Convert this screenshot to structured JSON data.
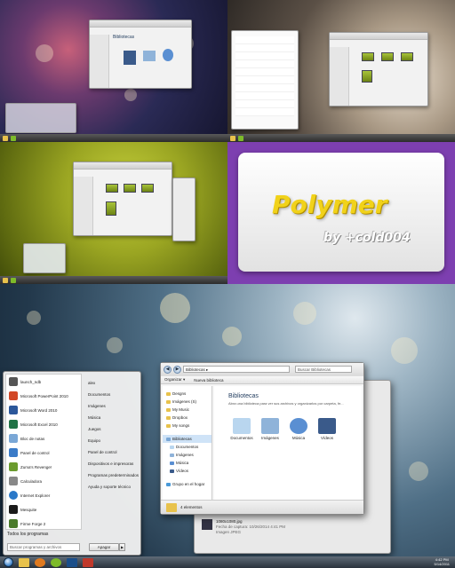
{
  "collage": {
    "polymer_title": "Polymer",
    "polymer_byline": "by +cold004"
  },
  "mini_explorer": {
    "title": "Bibliotecas"
  },
  "start_menu": {
    "programs": [
      {
        "label": "launch_ndb",
        "color": "#555555"
      },
      {
        "label": "Microsoft PowerPoint 2010",
        "color": "#d24726"
      },
      {
        "label": "Microsoft Word 2010",
        "color": "#2b579a"
      },
      {
        "label": "Microsoft Excel 2010",
        "color": "#217346"
      },
      {
        "label": "Bloc de notas",
        "color": "#7aa7d6"
      },
      {
        "label": "Panel de control",
        "color": "#3a7bc8"
      },
      {
        "label": "Zuma's Revenge!",
        "color": "#6b9b2e"
      },
      {
        "label": "Calculadora",
        "color": "#888888"
      },
      {
        "label": "Internet Explorer",
        "color": "#2a78c8"
      },
      {
        "label": "Mesquite",
        "color": "#1a1a1a"
      },
      {
        "label": "Firme Forge 2",
        "color": "#4a7a2a"
      }
    ],
    "all_programs": "Todos los programas",
    "search_placeholder": "Buscar programas y archivos",
    "right_links": [
      "alex",
      "Documentos",
      "Imágenes",
      "Música",
      "Juegos",
      "Equipo",
      "Panel de control",
      "Dispositivos e impresoras",
      "Programas predeterminados",
      "Ayuda y soporte técnico"
    ],
    "shutdown": "Apagar",
    "shutdown_arrow": "▶"
  },
  "explorer": {
    "address": "Bibliotecas ▸",
    "search": "Buscar Bibliotecas",
    "back": "◀",
    "forward": "▶",
    "commands": [
      "Organizar ▾",
      "Nueva biblioteca"
    ],
    "nav": [
      "Desgns",
      "Imágenes (S)",
      "My Music",
      "Dropbox",
      "My songs",
      "Bibliotecas",
      "Documentos",
      "Imágenes",
      "Música",
      "Vídeos",
      "Grupo en el hogar"
    ],
    "title": "Bibliotecas",
    "subtitle": "Abra una biblioteca para ver sus archivos y organizarlos por carpeta, fe...",
    "libraries": [
      {
        "label": "Documentos",
        "color": "#b9d6ef"
      },
      {
        "label": "Imágenes",
        "color": "#8fb3d9"
      },
      {
        "label": "Música",
        "color": "#5a8fd2"
      },
      {
        "label": "Vídeos",
        "color": "#3a5a8a"
      }
    ],
    "status": "4 elementos"
  },
  "behind_window": {
    "file_name": "1080x1080.jpg",
    "file_date": "Fecha de captura: 10/26/2014 4:41 PM",
    "file_type": "Imagen JPEG"
  },
  "taskbar": {
    "apps": [
      {
        "name": "explorer",
        "color": "#e8c24c"
      },
      {
        "name": "media-player",
        "color": "#e07a1f"
      },
      {
        "name": "utorrent",
        "color": "#7dbb2a"
      },
      {
        "name": "photoshop",
        "color": "#1b4f8a"
      },
      {
        "name": "tool",
        "color": "#c0392b"
      }
    ],
    "clock_time": "4:42 PM",
    "clock_date": "5/14/2011"
  }
}
